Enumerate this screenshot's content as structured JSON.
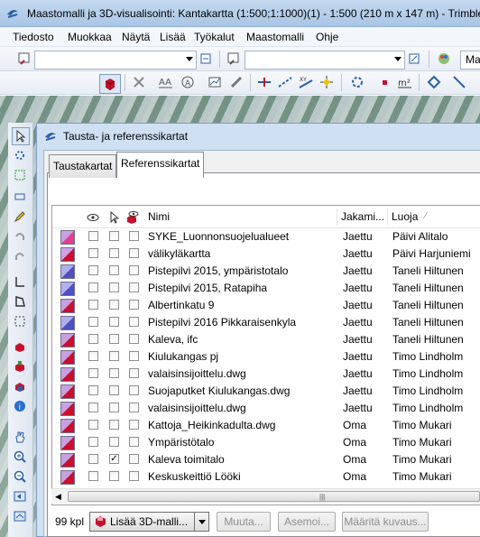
{
  "window": {
    "title": "Maastomalli ja 3D-visualisointi: Kantakartta  (1:500;1:1000)(1) - 1:500 (210 m x 147 m) - Trimble"
  },
  "menu": [
    "Tiedosto",
    "Muokkaa",
    "Näytä",
    "Lisää",
    "Työkalut",
    "Maastomalli",
    "Ohje"
  ],
  "toolbar": {
    "combo3_text": "Maa"
  },
  "dialog": {
    "title": "Tausta- ja referenssikartat",
    "tabs": [
      "Taustakartat",
      "Referenssikartat"
    ],
    "active_tab": "Referenssikartat"
  },
  "table": {
    "headers": {
      "name": "Nimi",
      "shared": "Jakami...",
      "creator": "Luoja"
    },
    "rows": [
      {
        "name": "SYKE_Luonnonsuojelualueet",
        "shared": "Jaettu",
        "creator": "Päivi Alitalo",
        "checked": false
      },
      {
        "name": "välikyläkartta",
        "shared": "Jaettu",
        "creator": "Päivi Harjuniemi",
        "checked": false
      },
      {
        "name": "Pistepilvi 2015, ympäristotalo",
        "shared": "Jaettu",
        "creator": "Taneli Hiltunen",
        "checked": false
      },
      {
        "name": "Pistepilvi 2015, Ratapiha",
        "shared": "Jaettu",
        "creator": "Taneli Hiltunen",
        "checked": false
      },
      {
        "name": "Albertinkatu 9",
        "shared": "Jaettu",
        "creator": "Taneli Hiltunen",
        "checked": false
      },
      {
        "name": "Pistepilvi 2016 Pikkaraisenkyla",
        "shared": "Jaettu",
        "creator": "Taneli Hiltunen",
        "checked": false
      },
      {
        "name": "Kaleva, ifc",
        "shared": "Jaettu",
        "creator": "Taneli Hiltunen",
        "checked": false
      },
      {
        "name": "Kiulukangas pj",
        "shared": "Jaettu",
        "creator": "Timo Lindholm",
        "checked": false
      },
      {
        "name": "valaisinsijoittelu.dwg",
        "shared": "Jaettu",
        "creator": "Timo Lindholm",
        "checked": false
      },
      {
        "name": "Suojaputket Kiulukangas.dwg",
        "shared": "Jaettu",
        "creator": "Timo Lindholm",
        "checked": false
      },
      {
        "name": "valaisinsijoittelu.dwg",
        "shared": "Jaettu",
        "creator": "Timo Lindholm",
        "checked": false
      },
      {
        "name": "Kattoja_Heikinkadulta.dwg",
        "shared": "Oma",
        "creator": "Timo Mukari",
        "checked": false
      },
      {
        "name": "Ympäristötalo",
        "shared": "Oma",
        "creator": "Timo Mukari",
        "checked": false
      },
      {
        "name": "Kaleva toimitalo",
        "shared": "Oma",
        "creator": "Timo Mukari",
        "checked": true
      },
      {
        "name": "Keskuskeittiö Lööki",
        "shared": "Oma",
        "creator": "Timo Mukari",
        "checked": false
      }
    ]
  },
  "footer": {
    "count": "99 kpl",
    "add_model": "Lisää 3D-malli...",
    "edit": "Muuta...",
    "settings": "Asemoi...",
    "define": "Määritä kuvaus..."
  },
  "colors": {
    "title_bar": "#b8d0ec",
    "dialog_frame": "#cfe0f3",
    "red_accent": "#c8102e"
  }
}
